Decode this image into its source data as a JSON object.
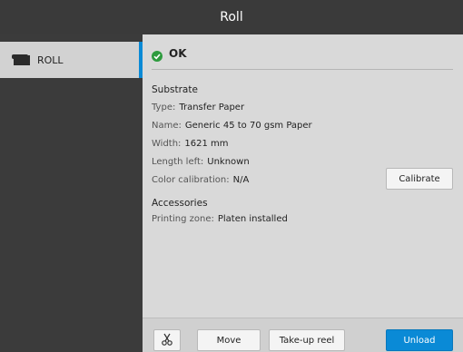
{
  "window": {
    "title": "Roll"
  },
  "sidebar": {
    "items": [
      {
        "label": "ROLL",
        "icon": "roll-icon",
        "selected": true
      }
    ]
  },
  "status": {
    "text": "OK",
    "icon": "check-circle-icon",
    "color": "#2e9b3e"
  },
  "substrate": {
    "heading": "Substrate",
    "type_label": "Type:",
    "type_value": "Transfer Paper",
    "name_label": "Name:",
    "name_value": "Generic 45 to 70 gsm Paper",
    "width_label": "Width:",
    "width_value": "1621 mm",
    "length_label": "Length left:",
    "length_value": "Unknown",
    "color_label": "Color calibration:",
    "color_value": "N/A"
  },
  "calibrate_button": "Calibrate",
  "accessories": {
    "heading": "Accessories",
    "printing_zone_label": "Printing zone:",
    "printing_zone_value": "Platen installed"
  },
  "bottom_bar": {
    "cut_icon": "scissors-icon",
    "move": "Move",
    "takeup": "Take-up reel",
    "unload": "Unload"
  },
  "colors": {
    "accent": "#0a8ad6",
    "title_bar": "#3a3a3a",
    "sidebar": "#3b3b3b"
  }
}
